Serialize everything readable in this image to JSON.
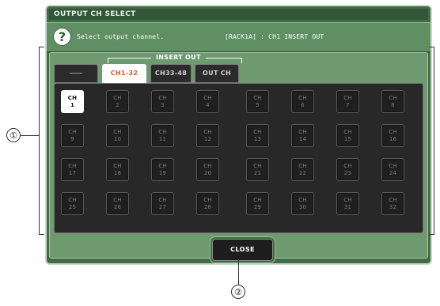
{
  "window": {
    "title": "OUTPUT CH SELECT",
    "message": "Select output channel.",
    "target": "[RACK1A] : CH1 INSERT OUT"
  },
  "tabs": {
    "group_label": "INSERT OUT",
    "blank_label": "—",
    "items": [
      {
        "label": "CH1-32",
        "active": true
      },
      {
        "label": "CH33-48",
        "active": false
      },
      {
        "label": "OUT CH",
        "active": false
      }
    ]
  },
  "channels": [
    {
      "label": "CH",
      "num": "1",
      "selected": true
    },
    {
      "label": "CH",
      "num": "2"
    },
    {
      "label": "CH",
      "num": "3"
    },
    {
      "label": "CH",
      "num": "4"
    },
    {
      "label": "CH",
      "num": "5"
    },
    {
      "label": "CH",
      "num": "6"
    },
    {
      "label": "CH",
      "num": "7"
    },
    {
      "label": "CH",
      "num": "8"
    },
    {
      "label": "CH",
      "num": "9"
    },
    {
      "label": "CH",
      "num": "10"
    },
    {
      "label": "CH",
      "num": "11"
    },
    {
      "label": "CH",
      "num": "12"
    },
    {
      "label": "CH",
      "num": "13"
    },
    {
      "label": "CH",
      "num": "14"
    },
    {
      "label": "CH",
      "num": "15"
    },
    {
      "label": "CH",
      "num": "16"
    },
    {
      "label": "CH",
      "num": "17"
    },
    {
      "label": "CH",
      "num": "18"
    },
    {
      "label": "CH",
      "num": "19"
    },
    {
      "label": "CH",
      "num": "20"
    },
    {
      "label": "CH",
      "num": "21"
    },
    {
      "label": "CH",
      "num": "22"
    },
    {
      "label": "CH",
      "num": "23"
    },
    {
      "label": "CH",
      "num": "24"
    },
    {
      "label": "CH",
      "num": "25"
    },
    {
      "label": "CH",
      "num": "26"
    },
    {
      "label": "CH",
      "num": "27"
    },
    {
      "label": "CH",
      "num": "28"
    },
    {
      "label": "CH",
      "num": "29"
    },
    {
      "label": "CH",
      "num": "30"
    },
    {
      "label": "CH",
      "num": "31"
    },
    {
      "label": "CH",
      "num": "32"
    }
  ],
  "close_label": "CLOSE",
  "callouts": {
    "one": "①",
    "two": "②"
  },
  "colors": {
    "window_green": "#3f6b45",
    "active_tab_text": "#e05a2a",
    "grid_bg": "#282828"
  }
}
